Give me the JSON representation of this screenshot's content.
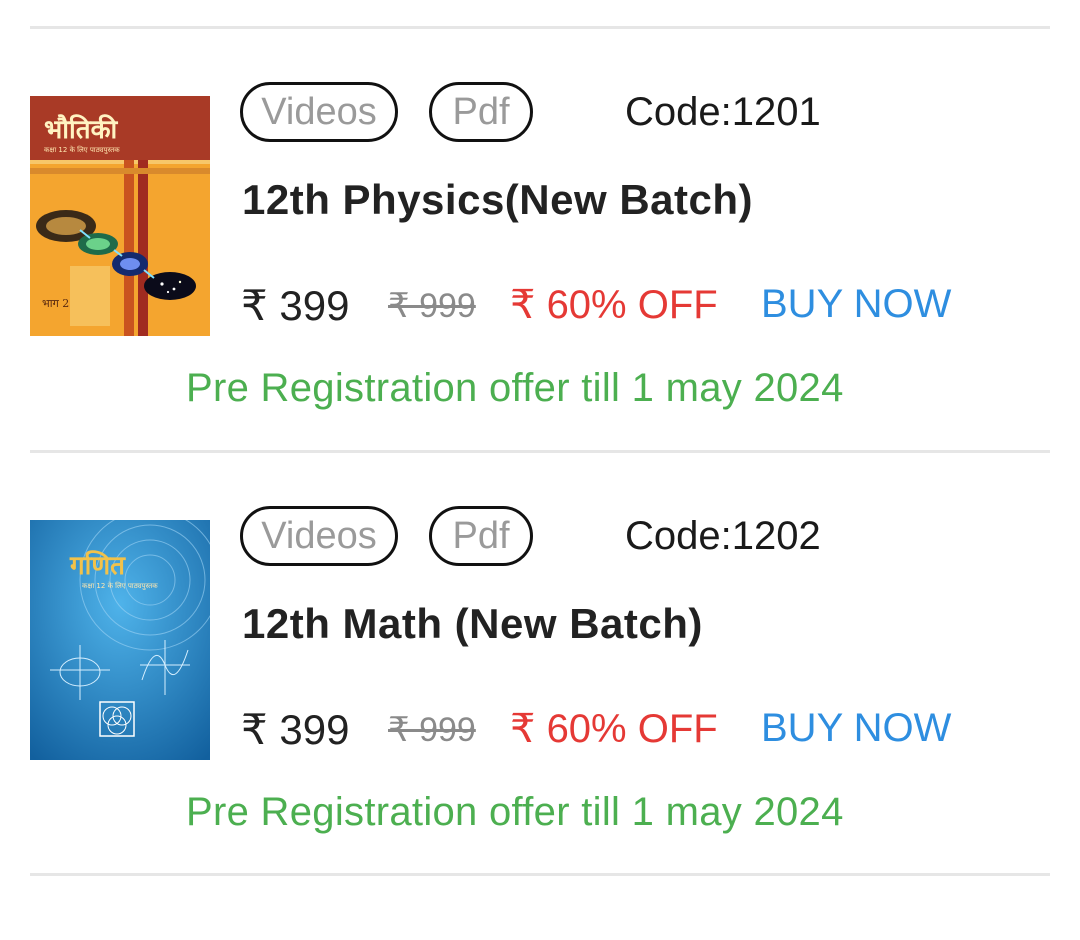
{
  "courses": [
    {
      "cover": {
        "title": "भौतिकी",
        "subtitle": "कक्षा 12 के लिए पाठ्यपुस्तक",
        "part": "भाग 2",
        "colors": {
          "top": "#a93a26",
          "body": "#f4a52f",
          "stripe": "#a02b20"
        },
        "icon": "physics-book-cover"
      },
      "tags": [
        "Videos",
        "Pdf"
      ],
      "code": "Code:1201",
      "title": "12th Physics(New Batch)",
      "price": "₹ 399",
      "mrp": "₹ 999",
      "discount": "₹ 60% OFF",
      "buy_label": "BUY NOW",
      "offer": "Pre Registration offer till 1 may 2024"
    },
    {
      "cover": {
        "title": "गणित",
        "subtitle": "कक्षा 12 के लिए पाठ्यपुस्तक",
        "colors": {
          "top": "#1565c0",
          "body": "#1e88c7",
          "title": "#f2c24a"
        },
        "icon": "math-book-cover"
      },
      "tags": [
        "Videos",
        "Pdf"
      ],
      "code": "Code:1202",
      "title": "12th Math (New Batch)",
      "price": "₹ 399",
      "mrp": "₹ 999",
      "discount": "₹ 60% OFF",
      "buy_label": "BUY NOW",
      "offer": "Pre Registration offer till 1 may 2024"
    }
  ],
  "colors": {
    "price": "#222222",
    "mrp": "#8a8a8a",
    "discount": "#e53935",
    "buy": "#2e8ee0",
    "offer": "#4caf50",
    "divider": "#e6e6e6"
  }
}
